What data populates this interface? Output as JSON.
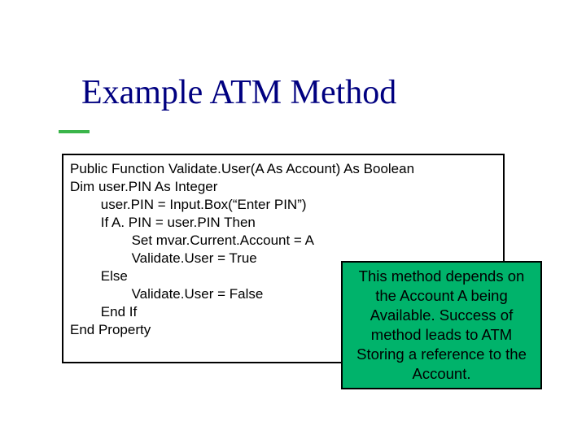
{
  "title": "Example ATM Method",
  "code": {
    "l0": "Public Function Validate.User(A As Account) As Boolean",
    "l1": "Dim user.PIN As Integer",
    "l2": "        user.PIN = Input.Box(“Enter PIN”)",
    "l3": "        If A. PIN = user.PIN Then",
    "l4": "                Set mvar.Current.Account = A",
    "l5": "                Validate.User = True",
    "l6": "        Else",
    "l7": "                Validate.User = False",
    "l8": "        End If",
    "l9": "End Property"
  },
  "note": "This method depends on the Account A being Available.  Success of method leads to ATM Storing a reference to the Account."
}
